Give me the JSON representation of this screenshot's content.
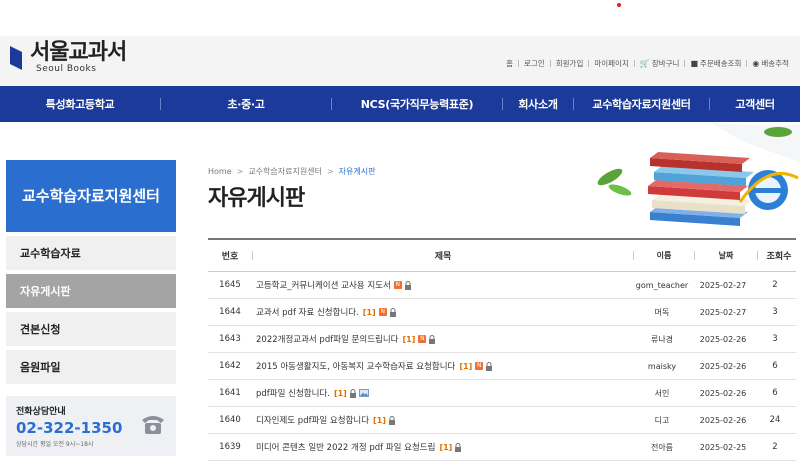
{
  "header": {
    "logo_ko": "서울교과서",
    "logo_en": "Seoul Books",
    "util": [
      {
        "label": "홈",
        "icon": ""
      },
      {
        "label": "로그인",
        "icon": ""
      },
      {
        "label": "회원가입",
        "icon": ""
      },
      {
        "label": "마이페이지",
        "icon": ""
      },
      {
        "label": "장바구니",
        "icon": "cart-icon"
      },
      {
        "label": "주문배송조회",
        "icon": "box-icon"
      },
      {
        "label": "배송추적",
        "icon": "globe-icon"
      }
    ]
  },
  "nav": {
    "items": [
      "특성화고등학교",
      "초·중·고",
      "NCS(국가직무능력표준)",
      "회사소개",
      "교수학습자료지원센터",
      "고객센터"
    ]
  },
  "sidebar": {
    "title": "교수학습자료지원센터",
    "items": [
      {
        "label": "교수학습자료",
        "active": false
      },
      {
        "label": "자유게시판",
        "active": true
      },
      {
        "label": "견본신청",
        "active": false
      },
      {
        "label": "음원파일",
        "active": false
      }
    ],
    "phone": {
      "title": "전화상담안내",
      "number": "02-322-1350",
      "hours": "상담시간 평일 오전 9시~18시"
    }
  },
  "breadcrumb": {
    "home": "Home",
    "parent": "교수학습자료지원센터",
    "current": "자유게시판",
    "sep": ">"
  },
  "page_title": "자유게시판",
  "board": {
    "headers": {
      "num": "번호",
      "subject": "제목",
      "name": "이름",
      "date": "날짜",
      "views": "조회수"
    },
    "rows": [
      {
        "num": "1645",
        "subject": "고등학교_커뮤니케이션 교사용 지도서",
        "comments": "",
        "name": "gom_teacher",
        "date": "2025-02-27",
        "views": "2"
      },
      {
        "num": "1644",
        "subject": "교과서 pdf 자료 신청합니다.",
        "comments": "[1]",
        "name": "머독",
        "date": "2025-02-27",
        "views": "3"
      },
      {
        "num": "1643",
        "subject": "2022개정교과서 pdf파일 문의드립니다",
        "comments": "[1]",
        "name": "류나경",
        "date": "2025-02-26",
        "views": "3"
      },
      {
        "num": "1642",
        "subject": "2015 아동생활지도, 아동복지 교수학습자료 요청합니다",
        "comments": "[1]",
        "name": "maisky",
        "date": "2025-02-26",
        "views": "6"
      },
      {
        "num": "1641",
        "subject": "pdf파일 신청합니다.",
        "comments": "[1]",
        "name": "서인",
        "date": "2025-02-26",
        "views": "6"
      },
      {
        "num": "1640",
        "subject": "디자인제도 pdf파일 요청합니다",
        "comments": "[1]",
        "name": "디고",
        "date": "2025-02-26",
        "views": "24"
      },
      {
        "num": "1639",
        "subject": "미디어 콘텐츠 일반 2022 개정 pdf 파일 요청드립",
        "comments": "[1]",
        "name": "전아름",
        "date": "2025-02-25",
        "views": "2"
      }
    ]
  },
  "colors": {
    "nav_bg": "#1b3a99",
    "sidebar_title_bg": "#2a6fd0",
    "active_item_bg": "#a4a4a4",
    "comment_count": "#e07000"
  }
}
